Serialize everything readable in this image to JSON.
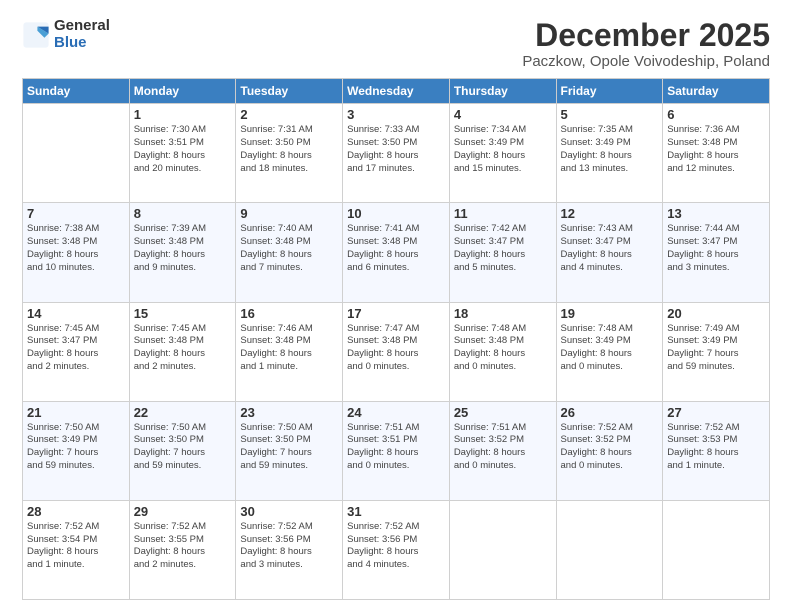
{
  "logo": {
    "general": "General",
    "blue": "Blue"
  },
  "header": {
    "month": "December 2025",
    "location": "Paczkow, Opole Voivodeship, Poland"
  },
  "weekdays": [
    "Sunday",
    "Monday",
    "Tuesday",
    "Wednesday",
    "Thursday",
    "Friday",
    "Saturday"
  ],
  "weeks": [
    [
      {
        "day": "",
        "info": ""
      },
      {
        "day": "1",
        "info": "Sunrise: 7:30 AM\nSunset: 3:51 PM\nDaylight: 8 hours\nand 20 minutes."
      },
      {
        "day": "2",
        "info": "Sunrise: 7:31 AM\nSunset: 3:50 PM\nDaylight: 8 hours\nand 18 minutes."
      },
      {
        "day": "3",
        "info": "Sunrise: 7:33 AM\nSunset: 3:50 PM\nDaylight: 8 hours\nand 17 minutes."
      },
      {
        "day": "4",
        "info": "Sunrise: 7:34 AM\nSunset: 3:49 PM\nDaylight: 8 hours\nand 15 minutes."
      },
      {
        "day": "5",
        "info": "Sunrise: 7:35 AM\nSunset: 3:49 PM\nDaylight: 8 hours\nand 13 minutes."
      },
      {
        "day": "6",
        "info": "Sunrise: 7:36 AM\nSunset: 3:48 PM\nDaylight: 8 hours\nand 12 minutes."
      }
    ],
    [
      {
        "day": "7",
        "info": "Sunrise: 7:38 AM\nSunset: 3:48 PM\nDaylight: 8 hours\nand 10 minutes."
      },
      {
        "day": "8",
        "info": "Sunrise: 7:39 AM\nSunset: 3:48 PM\nDaylight: 8 hours\nand 9 minutes."
      },
      {
        "day": "9",
        "info": "Sunrise: 7:40 AM\nSunset: 3:48 PM\nDaylight: 8 hours\nand 7 minutes."
      },
      {
        "day": "10",
        "info": "Sunrise: 7:41 AM\nSunset: 3:48 PM\nDaylight: 8 hours\nand 6 minutes."
      },
      {
        "day": "11",
        "info": "Sunrise: 7:42 AM\nSunset: 3:47 PM\nDaylight: 8 hours\nand 5 minutes."
      },
      {
        "day": "12",
        "info": "Sunrise: 7:43 AM\nSunset: 3:47 PM\nDaylight: 8 hours\nand 4 minutes."
      },
      {
        "day": "13",
        "info": "Sunrise: 7:44 AM\nSunset: 3:47 PM\nDaylight: 8 hours\nand 3 minutes."
      }
    ],
    [
      {
        "day": "14",
        "info": "Sunrise: 7:45 AM\nSunset: 3:47 PM\nDaylight: 8 hours\nand 2 minutes."
      },
      {
        "day": "15",
        "info": "Sunrise: 7:45 AM\nSunset: 3:48 PM\nDaylight: 8 hours\nand 2 minutes."
      },
      {
        "day": "16",
        "info": "Sunrise: 7:46 AM\nSunset: 3:48 PM\nDaylight: 8 hours\nand 1 minute."
      },
      {
        "day": "17",
        "info": "Sunrise: 7:47 AM\nSunset: 3:48 PM\nDaylight: 8 hours\nand 0 minutes."
      },
      {
        "day": "18",
        "info": "Sunrise: 7:48 AM\nSunset: 3:48 PM\nDaylight: 8 hours\nand 0 minutes."
      },
      {
        "day": "19",
        "info": "Sunrise: 7:48 AM\nSunset: 3:49 PM\nDaylight: 8 hours\nand 0 minutes."
      },
      {
        "day": "20",
        "info": "Sunrise: 7:49 AM\nSunset: 3:49 PM\nDaylight: 7 hours\nand 59 minutes."
      }
    ],
    [
      {
        "day": "21",
        "info": "Sunrise: 7:50 AM\nSunset: 3:49 PM\nDaylight: 7 hours\nand 59 minutes."
      },
      {
        "day": "22",
        "info": "Sunrise: 7:50 AM\nSunset: 3:50 PM\nDaylight: 7 hours\nand 59 minutes."
      },
      {
        "day": "23",
        "info": "Sunrise: 7:50 AM\nSunset: 3:50 PM\nDaylight: 7 hours\nand 59 minutes."
      },
      {
        "day": "24",
        "info": "Sunrise: 7:51 AM\nSunset: 3:51 PM\nDaylight: 8 hours\nand 0 minutes."
      },
      {
        "day": "25",
        "info": "Sunrise: 7:51 AM\nSunset: 3:52 PM\nDaylight: 8 hours\nand 0 minutes."
      },
      {
        "day": "26",
        "info": "Sunrise: 7:52 AM\nSunset: 3:52 PM\nDaylight: 8 hours\nand 0 minutes."
      },
      {
        "day": "27",
        "info": "Sunrise: 7:52 AM\nSunset: 3:53 PM\nDaylight: 8 hours\nand 1 minute."
      }
    ],
    [
      {
        "day": "28",
        "info": "Sunrise: 7:52 AM\nSunset: 3:54 PM\nDaylight: 8 hours\nand 1 minute."
      },
      {
        "day": "29",
        "info": "Sunrise: 7:52 AM\nSunset: 3:55 PM\nDaylight: 8 hours\nand 2 minutes."
      },
      {
        "day": "30",
        "info": "Sunrise: 7:52 AM\nSunset: 3:56 PM\nDaylight: 8 hours\nand 3 minutes."
      },
      {
        "day": "31",
        "info": "Sunrise: 7:52 AM\nSunset: 3:56 PM\nDaylight: 8 hours\nand 4 minutes."
      },
      {
        "day": "",
        "info": ""
      },
      {
        "day": "",
        "info": ""
      },
      {
        "day": "",
        "info": ""
      }
    ]
  ]
}
